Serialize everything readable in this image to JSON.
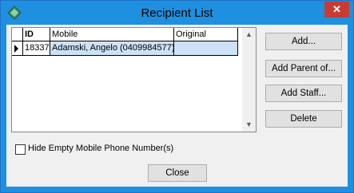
{
  "window": {
    "title": "Recipient List",
    "close_glyph": "✕"
  },
  "grid": {
    "columns": [
      {
        "label": "ID"
      },
      {
        "label": "Mobile"
      },
      {
        "label": "Original"
      }
    ],
    "rows": [
      {
        "id": "18337",
        "mobile": "Adamski, Angelo (0409984577)",
        "original": ""
      }
    ],
    "scroll_up": "▲",
    "scroll_down": "▼"
  },
  "buttons": {
    "add": "Add...",
    "add_parent": "Add Parent of...",
    "add_staff": "Add Staff...",
    "delete": "Delete",
    "close": "Close"
  },
  "checkbox": {
    "label": "Hide Empty Mobile Phone Number(s)",
    "checked": false
  }
}
